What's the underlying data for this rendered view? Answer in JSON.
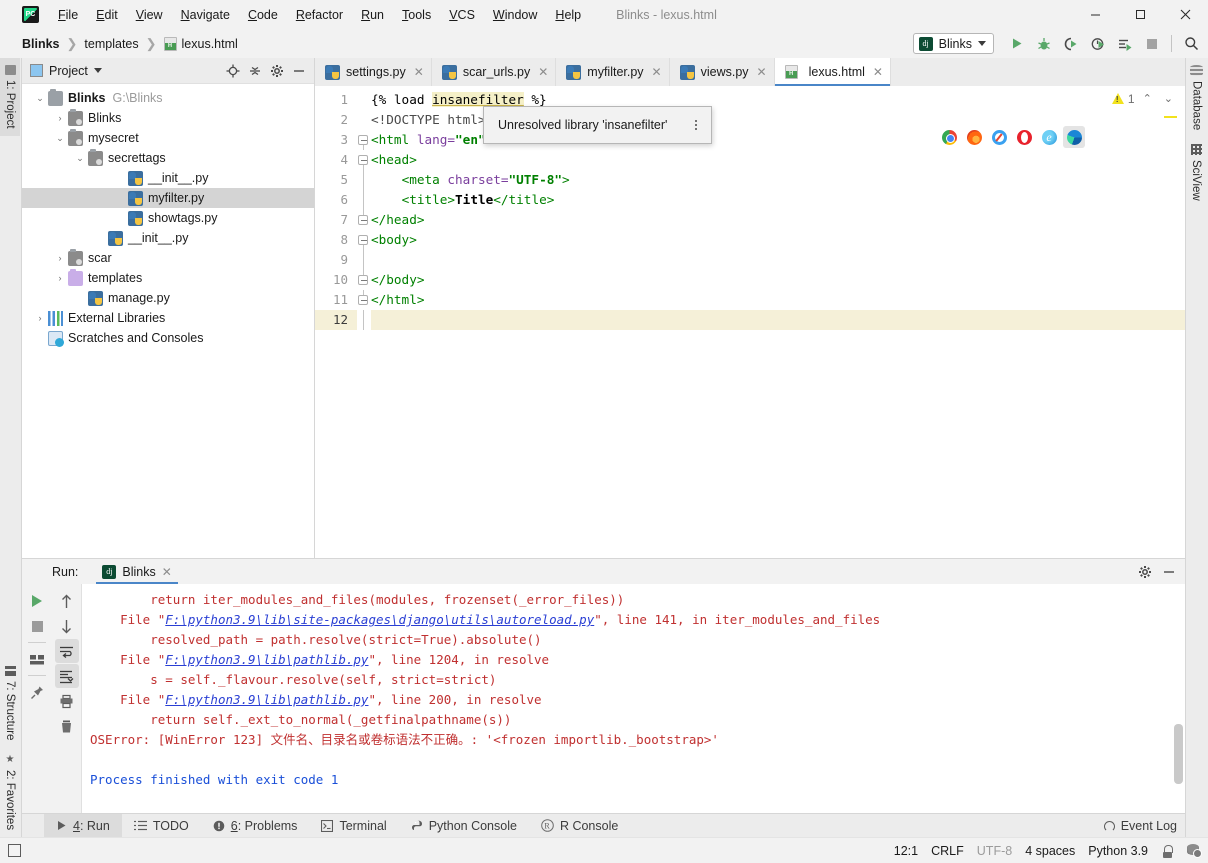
{
  "window": {
    "title": "Blinks - lexus.html",
    "app_icon": "pycharm-logo-icon",
    "controls": {
      "minimize": "—",
      "maximize": "☐",
      "close": "✕"
    }
  },
  "menubar": {
    "items": [
      {
        "label": "File"
      },
      {
        "label": "Edit"
      },
      {
        "label": "View"
      },
      {
        "label": "Navigate"
      },
      {
        "label": "Code"
      },
      {
        "label": "Refactor"
      },
      {
        "label": "Run"
      },
      {
        "label": "Tools"
      },
      {
        "label": "VCS"
      },
      {
        "label": "Window"
      },
      {
        "label": "Help"
      }
    ]
  },
  "breadcrumb": {
    "items": [
      "Blinks",
      "templates",
      "lexus.html"
    ],
    "separator": "❯"
  },
  "toolbar": {
    "run_config": {
      "label": "Blinks",
      "icon": "django-icon"
    },
    "buttons": [
      {
        "name": "run-button",
        "icon": "play-icon"
      },
      {
        "name": "debug-button",
        "icon": "bug-icon"
      },
      {
        "name": "run-coverage-button",
        "icon": "run-coverage-icon"
      },
      {
        "name": "profile-button",
        "icon": "profile-icon"
      },
      {
        "name": "attach-button",
        "icon": "attach-icon"
      },
      {
        "name": "stop-button",
        "icon": "stop-icon"
      },
      {
        "name": "search-everywhere-button",
        "icon": "search-icon"
      }
    ]
  },
  "left_rail": {
    "tabs": [
      {
        "label": "1: Project",
        "active": true,
        "icon": "project-icon"
      },
      {
        "label": "7: Structure",
        "icon": "structure-icon"
      },
      {
        "label": "2: Favorites",
        "icon": "star-icon"
      }
    ]
  },
  "right_rail": {
    "tabs": [
      {
        "label": "Database",
        "icon": "database-icon"
      },
      {
        "label": "SciView",
        "icon": "grid-icon"
      }
    ]
  },
  "project_panel": {
    "title": "Project",
    "header_buttons": [
      "locate-icon",
      "collapse-all-icon",
      "gear-icon",
      "hide-icon"
    ],
    "tree": [
      {
        "label": "Blinks",
        "path": "G:\\Blinks",
        "indent": 0,
        "twisty": "⌄",
        "icon": "folder-root-icon",
        "bold": true
      },
      {
        "label": "Blinks",
        "indent": 1,
        "twisty": "›",
        "icon": "folder-module-icon"
      },
      {
        "label": "mysecret",
        "indent": 1,
        "twisty": "⌄",
        "icon": "folder-module-icon"
      },
      {
        "label": "secrettags",
        "indent": 2,
        "twisty": "⌄",
        "icon": "folder-module-icon"
      },
      {
        "label": "__init__.py",
        "indent": 4,
        "twisty": "",
        "icon": "python-file-icon"
      },
      {
        "label": "myfilter.py",
        "indent": 4,
        "twisty": "",
        "icon": "python-file-icon",
        "selected": true
      },
      {
        "label": "showtags.py",
        "indent": 4,
        "twisty": "",
        "icon": "python-file-icon"
      },
      {
        "label": "__init__.py",
        "indent": 3,
        "twisty": "",
        "icon": "python-file-icon"
      },
      {
        "label": "scar",
        "indent": 1,
        "twisty": "›",
        "icon": "folder-module-icon"
      },
      {
        "label": "templates",
        "indent": 1,
        "twisty": "›",
        "icon": "folder-template-icon"
      },
      {
        "label": "manage.py",
        "indent": 2,
        "twisty": "",
        "icon": "python-file-icon"
      },
      {
        "label": "External Libraries",
        "indent": 0,
        "twisty": "›",
        "icon": "libraries-icon"
      },
      {
        "label": "Scratches and Consoles",
        "indent": 0,
        "twisty": "",
        "icon": "scratches-icon"
      }
    ]
  },
  "editor": {
    "tabs": [
      {
        "label": "settings.py",
        "icon": "python-file-icon",
        "active": false
      },
      {
        "label": "scar_urls.py",
        "icon": "python-file-icon",
        "active": false
      },
      {
        "label": "myfilter.py",
        "icon": "python-file-icon",
        "active": false
      },
      {
        "label": "views.py",
        "icon": "python-file-icon",
        "active": false
      },
      {
        "label": "lexus.html",
        "icon": "html-file-icon",
        "active": true
      }
    ],
    "close_glyph": "✕",
    "line_numbers": [
      "1",
      "2",
      "3",
      "4",
      "5",
      "6",
      "7",
      "8",
      "9",
      "10",
      "11",
      "12"
    ],
    "current_line": 12,
    "lines": [
      {
        "n": 1,
        "indent": 0,
        "fold": "",
        "segments": [
          {
            "t": "{% load ",
            "c": "tpl"
          },
          {
            "t": "insanefilter",
            "c": "err"
          },
          {
            "t": " %}",
            "c": "tpl"
          }
        ]
      },
      {
        "n": 2,
        "indent": 0,
        "fold": "",
        "segments": [
          {
            "t": "<!DOCTYPE html>",
            "c": "doctype"
          }
        ]
      },
      {
        "n": 3,
        "indent": 0,
        "fold": "open",
        "segments": [
          {
            "t": "<html ",
            "c": "tag"
          },
          {
            "t": "lang=",
            "c": "attr"
          },
          {
            "t": "\"en\"",
            "c": "str"
          },
          {
            "t": ">",
            "c": "tag"
          }
        ]
      },
      {
        "n": 4,
        "indent": 0,
        "fold": "open",
        "segments": [
          {
            "t": "<head>",
            "c": "tag"
          }
        ]
      },
      {
        "n": 5,
        "indent": 4,
        "fold": "line",
        "segments": [
          {
            "t": "<meta ",
            "c": "tag"
          },
          {
            "t": "charset=",
            "c": "attr"
          },
          {
            "t": "\"UTF-8\"",
            "c": "str"
          },
          {
            "t": ">",
            "c": "tag"
          }
        ]
      },
      {
        "n": 6,
        "indent": 4,
        "fold": "line",
        "segments": [
          {
            "t": "<title>",
            "c": "tag"
          },
          {
            "t": "Title",
            "c": "txt"
          },
          {
            "t": "</title>",
            "c": "tag"
          }
        ]
      },
      {
        "n": 7,
        "indent": 0,
        "fold": "close",
        "segments": [
          {
            "t": "</head>",
            "c": "tag"
          }
        ]
      },
      {
        "n": 8,
        "indent": 0,
        "fold": "open",
        "segments": [
          {
            "t": "<body>",
            "c": "tag"
          }
        ]
      },
      {
        "n": 9,
        "indent": 0,
        "fold": "line",
        "segments": [
          {
            "t": "",
            "c": "tpl"
          }
        ]
      },
      {
        "n": 10,
        "indent": 0,
        "fold": "close",
        "segments": [
          {
            "t": "</body>",
            "c": "tag"
          }
        ]
      },
      {
        "n": 11,
        "indent": 0,
        "fold": "close",
        "segments": [
          {
            "t": "</html>",
            "c": "tag"
          }
        ]
      },
      {
        "n": 12,
        "indent": 0,
        "fold": "line",
        "segments": [
          {
            "t": "",
            "c": "tpl"
          }
        ]
      }
    ],
    "inspection_tooltip": {
      "message": "Unresolved library 'insanefilter'",
      "menu_icon": "kebab-menu-icon"
    },
    "browser_preview": [
      {
        "name": "chrome-icon",
        "selected": false
      },
      {
        "name": "firefox-icon",
        "selected": false
      },
      {
        "name": "safari-icon",
        "selected": false
      },
      {
        "name": "opera-icon",
        "selected": false
      },
      {
        "name": "internet-explorer-icon",
        "selected": false
      },
      {
        "name": "edge-icon",
        "selected": true
      }
    ],
    "inspection_widget": {
      "warning_count": "1",
      "warning_icon": "warning-triangle-icon",
      "prev_glyph": "⌃",
      "next_glyph": "⌄"
    }
  },
  "run_panel": {
    "header_label": "Run:",
    "tab": {
      "label": "Blinks",
      "icon": "django-icon",
      "close_glyph": "✕"
    },
    "header_buttons": [
      "gear-icon",
      "hide-icon"
    ],
    "left_toolbar": [
      {
        "name": "rerun-button",
        "icon": "play-icon"
      },
      {
        "name": "stop-button",
        "icon": "stop-icon"
      },
      {
        "name": "layout-button",
        "icon": "layout-icon"
      },
      {
        "name": "pin-tab-button",
        "icon": "pin-icon"
      }
    ],
    "mid_toolbar": [
      {
        "name": "up-stacktrace-button",
        "icon": "arrow-up-icon"
      },
      {
        "name": "down-stacktrace-button",
        "icon": "arrow-down-icon"
      },
      {
        "name": "soft-wrap-button",
        "icon": "soft-wrap-icon",
        "toggled": true
      },
      {
        "name": "scroll-to-end-button",
        "icon": "scroll-end-icon",
        "toggled": true
      },
      {
        "name": "print-button",
        "icon": "printer-icon"
      },
      {
        "name": "clear-all-button",
        "icon": "trash-icon"
      }
    ],
    "console_lines": [
      {
        "indent": 4,
        "segments": [
          {
            "t": "return iter_modules_and_files(modules, frozenset(_error_files))",
            "c": "err"
          }
        ]
      },
      {
        "indent": 2,
        "segments": [
          {
            "t": "File \"",
            "c": "err"
          },
          {
            "t": "F:\\python3.9\\lib\\site-packages\\django\\utils\\autoreload.py",
            "c": "link"
          },
          {
            "t": "\", line 141, in iter_modules_and_files",
            "c": "err"
          }
        ]
      },
      {
        "indent": 4,
        "segments": [
          {
            "t": "resolved_path = path.resolve(strict=True).absolute()",
            "c": "err"
          }
        ]
      },
      {
        "indent": 2,
        "segments": [
          {
            "t": "File \"",
            "c": "err"
          },
          {
            "t": "F:\\python3.9\\lib\\pathlib.py",
            "c": "link"
          },
          {
            "t": "\", line 1204, in resolve",
            "c": "err"
          }
        ]
      },
      {
        "indent": 4,
        "segments": [
          {
            "t": "s = self._flavour.resolve(self, strict=strict)",
            "c": "err"
          }
        ]
      },
      {
        "indent": 2,
        "segments": [
          {
            "t": "File \"",
            "c": "err"
          },
          {
            "t": "F:\\python3.9\\lib\\pathlib.py",
            "c": "link"
          },
          {
            "t": "\", line 200, in resolve",
            "c": "err"
          }
        ]
      },
      {
        "indent": 4,
        "segments": [
          {
            "t": "return self._ext_to_normal(_getfinalpathname(s))",
            "c": "err"
          }
        ]
      },
      {
        "indent": 0,
        "segments": [
          {
            "t": "OSError: [WinError 123] 文件名、目录名或卷标语法不正确。: '<frozen importlib._bootstrap>'",
            "c": "err"
          }
        ]
      },
      {
        "indent": 0,
        "segments": [
          {
            "t": "",
            "c": "err"
          }
        ]
      },
      {
        "indent": 0,
        "segments": [
          {
            "t": "Process finished with exit code 1",
            "c": "blue"
          }
        ]
      }
    ]
  },
  "tool_window_bar": {
    "items": [
      {
        "label": "4: Run",
        "underline": "4",
        "icon": "play-icon",
        "active": true
      },
      {
        "label": "TODO",
        "icon": "todo-list-icon",
        "active": false
      },
      {
        "label": "6: Problems",
        "underline": "6",
        "icon": "problems-icon",
        "active": false
      },
      {
        "label": "Terminal",
        "icon": "terminal-icon",
        "active": false
      },
      {
        "label": "Python Console",
        "icon": "python-icon",
        "active": false
      },
      {
        "label": "R Console",
        "icon": "r-console-icon",
        "active": false
      }
    ],
    "event_log": {
      "label": "Event Log",
      "icon": "event-log-icon"
    }
  },
  "status_bar": {
    "caret_position": "12:1",
    "line_separator": "CRLF",
    "encoding": "UTF-8",
    "indent": "4 spaces",
    "interpreter": "Python 3.9",
    "icons": [
      "lock-icon",
      "database-inspection-icon"
    ]
  }
}
